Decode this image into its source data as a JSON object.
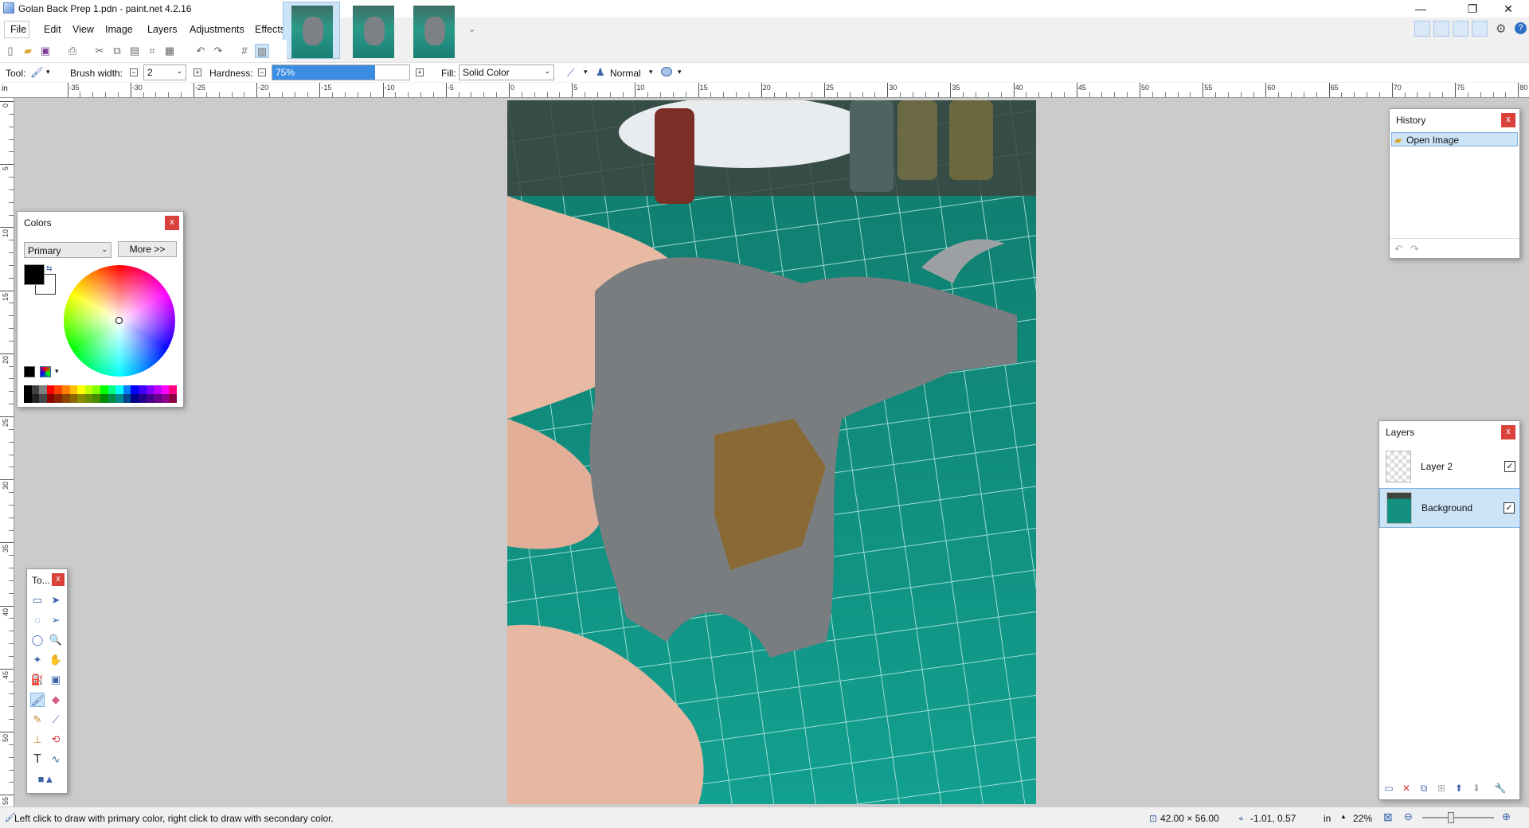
{
  "window": {
    "title": "Golan Back Prep 1.pdn - paint.net 4.2.16",
    "controls": {
      "minimize": "—",
      "maximize": "❐",
      "close": "✕"
    }
  },
  "menu": [
    "File",
    "Edit",
    "View",
    "Image",
    "Layers",
    "Adjustments",
    "Effects"
  ],
  "document_tabs": {
    "count": 3,
    "active_index": 0,
    "overflow_icon": "chevron-down-icon"
  },
  "right_tools": {
    "settings_icon": "gear-icon",
    "help_icon": "help-icon"
  },
  "toolbar": {
    "tool_label": "Tool:",
    "brush_width_label": "Brush width:",
    "brush_width_value": "2",
    "hardness_label": "Hardness:",
    "hardness_value": "75%",
    "hardness_fraction": 0.75,
    "fill_label": "Fill:",
    "fill_value": "Solid Color",
    "blend_mode": "Normal"
  },
  "ruler": {
    "unit": "in",
    "top_ticks": [
      "-35",
      "-30",
      "-25",
      "-20",
      "-15",
      "-10",
      "-5",
      "0",
      "5",
      "10",
      "15",
      "20",
      "25",
      "30",
      "35",
      "40",
      "45",
      "50",
      "55",
      "60",
      "65",
      "70",
      "75",
      "80"
    ],
    "left_ticks": [
      "0",
      "5",
      "10",
      "15",
      "20",
      "25",
      "30",
      "35",
      "40",
      "45",
      "50",
      "55"
    ]
  },
  "colors_panel": {
    "title": "Colors",
    "mode": "Primary",
    "more_button": "More >>",
    "primary_color": "#000000",
    "secondary_color": "#ffffff",
    "palette": [
      "#000000",
      "#404040",
      "#808080",
      "#ff0000",
      "#ff4000",
      "#ff8000",
      "#ffbf00",
      "#ffff00",
      "#bfff00",
      "#80ff00",
      "#00ff00",
      "#00ff80",
      "#00ffff",
      "#0080ff",
      "#0000ff",
      "#4000ff",
      "#8000ff",
      "#bf00ff",
      "#ff00ff",
      "#ff0080"
    ]
  },
  "tools_panel": {
    "title": "To..."
  },
  "history_panel": {
    "title": "History",
    "items": [
      "Open Image"
    ]
  },
  "layers_panel": {
    "title": "Layers",
    "layers": [
      "Layer 2",
      "Background"
    ],
    "selected": 1
  },
  "status": {
    "hint": "Left click to draw with primary color, right click to draw with secondary color.",
    "image_size": "42.00 × 56.00",
    "cursor_pos": "-1.01, 0.57",
    "unit": "in",
    "zoom": "22%"
  }
}
